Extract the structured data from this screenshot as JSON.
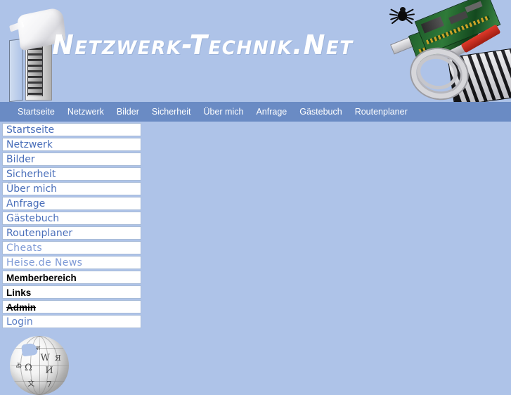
{
  "site": {
    "title": "Netzwerk-Technik.Net",
    "background_color": "#aec3e8",
    "navbar_color": "#6a8bc4",
    "link_color": "#4a6fba"
  },
  "banner": {
    "title": "Netzwerk-Technik.Net",
    "graphics": {
      "left": "server-rack-cabinet-image",
      "right": "network-hardware-collage-image",
      "spider": "spider-image"
    }
  },
  "navbar": {
    "items": [
      {
        "label": "Startseite",
        "name": "nav-startseite"
      },
      {
        "label": "Netzwerk",
        "name": "nav-netzwerk"
      },
      {
        "label": "Bilder",
        "name": "nav-bilder"
      },
      {
        "label": "Sicherheit",
        "name": "nav-sicherheit"
      },
      {
        "label": "Über mich",
        "name": "nav-ueber-mich"
      },
      {
        "label": "Anfrage",
        "name": "nav-anfrage"
      },
      {
        "label": "Gästebuch",
        "name": "nav-gaestebuch"
      },
      {
        "label": "Routenplaner",
        "name": "nav-routenplaner"
      }
    ]
  },
  "sidebar": {
    "items": [
      {
        "label": "Startseite",
        "style": "",
        "name": "sidebar-item-startseite"
      },
      {
        "label": "Netzwerk",
        "style": "",
        "name": "sidebar-item-netzwerk"
      },
      {
        "label": "Bilder",
        "style": "",
        "name": "sidebar-item-bilder"
      },
      {
        "label": "Sicherheit",
        "style": "",
        "name": "sidebar-item-sicherheit"
      },
      {
        "label": "Über mich",
        "style": "",
        "name": "sidebar-item-ueber-mich"
      },
      {
        "label": "Anfrage",
        "style": "",
        "name": "sidebar-item-anfrage"
      },
      {
        "label": "Gästebuch",
        "style": "",
        "name": "sidebar-item-gaestebuch"
      },
      {
        "label": "Routenplaner",
        "style": "",
        "name": "sidebar-item-routenplaner"
      },
      {
        "label": "Cheats",
        "style": "style-alt",
        "name": "sidebar-item-cheats"
      },
      {
        "label": "Heise.de News",
        "style": "style-alt",
        "name": "sidebar-item-heise-de-news"
      },
      {
        "label": "Memberbereich",
        "style": "style-bold",
        "name": "sidebar-item-memberbereich"
      },
      {
        "label": "Links",
        "style": "style-bold",
        "name": "sidebar-item-links"
      },
      {
        "label": "Admin ",
        "style": "style-strike",
        "name": "sidebar-item-admin"
      },
      {
        "label": "Login",
        "style": "style-login",
        "name": "sidebar-item-login"
      }
    ]
  },
  "footer": {
    "logo": "wikipedia-globe-logo",
    "globe_glyphs": [
      "W",
      "Ω",
      "И",
      "Я",
      "7",
      "文",
      "ゐ",
      "श"
    ]
  }
}
